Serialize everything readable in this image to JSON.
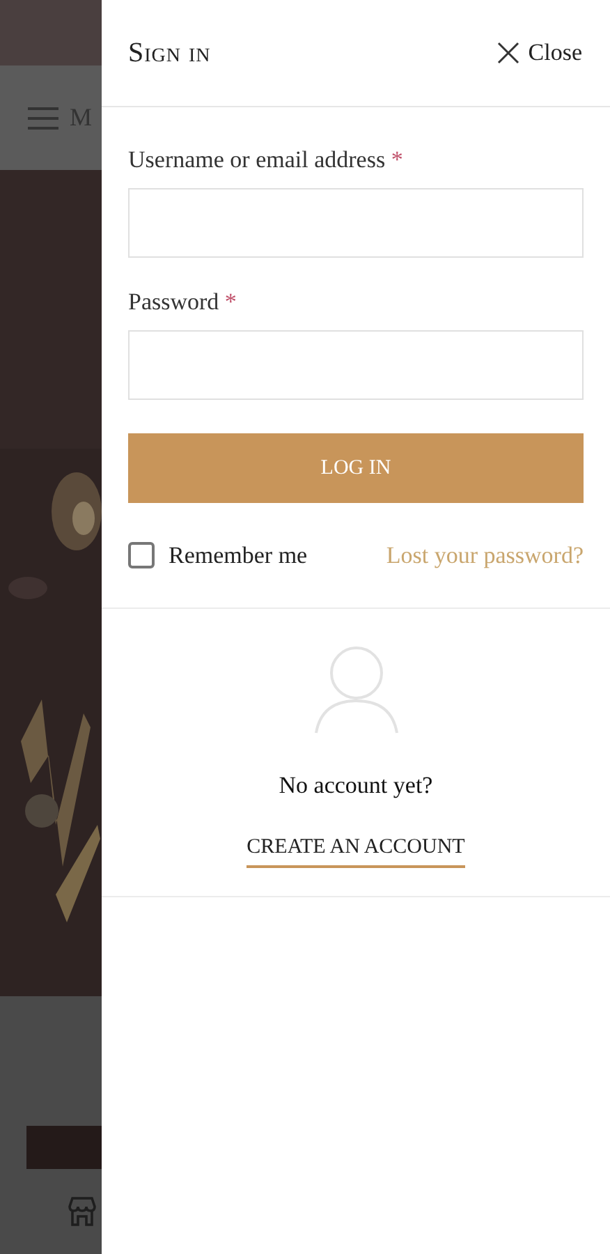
{
  "background": {
    "menu_label": "M"
  },
  "panel": {
    "title": "Sign in",
    "close_label": "Close",
    "fields": [
      {
        "label": "Username or email address",
        "required_mark": "*"
      },
      {
        "label": "Password",
        "required_mark": "*"
      }
    ],
    "login_button": "LOG IN",
    "remember": {
      "label": "Remember me",
      "checked": false
    },
    "lost_password": "Lost your password?",
    "no_account": "No account yet?",
    "create_account": "CREATE AN ACCOUNT"
  }
}
